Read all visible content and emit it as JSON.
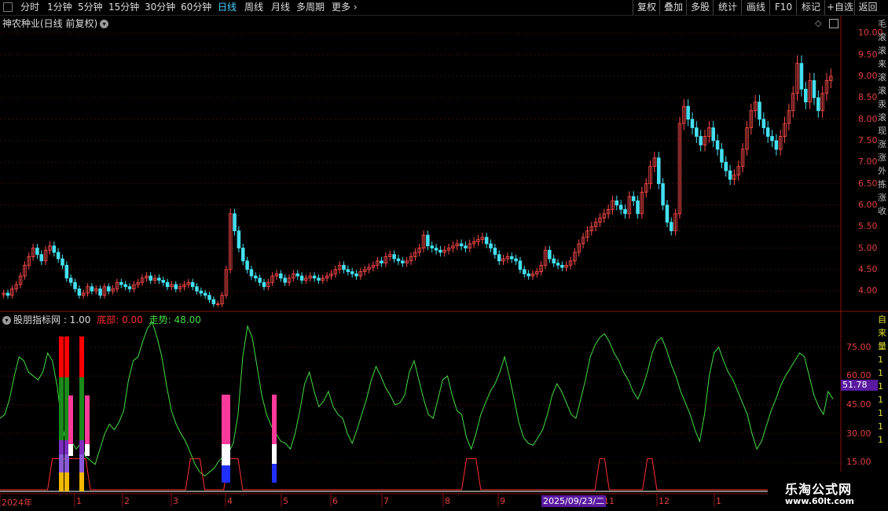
{
  "toolbar": {
    "periods": [
      "分时",
      "1分钟",
      "5分钟",
      "15分钟",
      "30分钟",
      "60分钟",
      "日线",
      "周线",
      "月线",
      "多周期",
      "更多"
    ],
    "active_period": "日线",
    "right_buttons": [
      "复权",
      "叠加",
      "多股",
      "统计",
      "画线",
      "F10",
      "标记",
      "+自选",
      "返回"
    ]
  },
  "main_chart": {
    "title": "神农种业(日线 前复权)",
    "price_axis": [
      "10.00",
      "9.50",
      "9.00",
      "8.50",
      "8.00",
      "7.50",
      "7.00",
      "6.50",
      "6.00",
      "5.50",
      "5.00",
      "4.50",
      "4.00"
    ]
  },
  "indicator": {
    "title": "股朋指标网 : 1.00",
    "bottom_label": "底部: 0.00",
    "trend_label": "走势: 48.00",
    "axis": [
      "75.00",
      "60.00",
      "45.00",
      "30.00",
      "15.00"
    ],
    "readout": "51.78"
  },
  "time_axis": {
    "labels": [
      "2024年",
      "1",
      "2",
      "3",
      "4",
      "5",
      "6",
      "7",
      "8",
      "9",
      "2025/09/23/二",
      "11",
      "12",
      "1"
    ]
  },
  "watermark": {
    "line1": "乐淘公式网",
    "line2": "www.60lt.com"
  },
  "right_strip_glyphs": [
    "毛",
    "滚",
    "滚",
    "来",
    "滚",
    "滚",
    "汞",
    "滚",
    "现",
    "涨",
    "涨",
    "外",
    "拣",
    "涨",
    "收"
  ],
  "right_strip_glyphs_lower": [
    "自",
    "来",
    "量",
    "1",
    "1",
    "1",
    "1",
    "1",
    "1",
    "1"
  ],
  "colors": {
    "up": "#ff4b4b",
    "down": "#44e0f0",
    "trend": "#44dd44",
    "bottom": "#ff3030",
    "accent": "#5a1aa0",
    "axis": "#e04040"
  },
  "chart_data": {
    "type": "candlestick",
    "price_ylim": [
      3.6,
      10.3
    ],
    "price_closes": [
      3.95,
      3.9,
      4.05,
      4.15,
      4.35,
      4.6,
      4.8,
      5.0,
      4.85,
      4.7,
      4.95,
      5.05,
      4.9,
      4.75,
      4.6,
      4.3,
      4.2,
      4.05,
      3.9,
      3.95,
      4.1,
      4.0,
      4.05,
      3.9,
      4.1,
      4.0,
      4.05,
      4.2,
      4.15,
      4.1,
      4.05,
      4.15,
      4.2,
      4.3,
      4.35,
      4.25,
      4.3,
      4.25,
      4.2,
      4.1,
      4.15,
      4.05,
      4.1,
      4.15,
      4.2,
      4.1,
      4.0,
      3.95,
      3.9,
      3.8,
      3.7,
      3.7,
      3.9,
      4.5,
      5.8,
      5.4,
      5.0,
      4.7,
      4.5,
      4.35,
      4.3,
      4.2,
      4.1,
      4.2,
      4.35,
      4.4,
      4.3,
      4.2,
      4.3,
      4.4,
      4.35,
      4.25,
      4.3,
      4.35,
      4.3,
      4.25,
      4.3,
      4.35,
      4.4,
      4.5,
      4.6,
      4.5,
      4.45,
      4.4,
      4.35,
      4.45,
      4.5,
      4.55,
      4.6,
      4.7,
      4.65,
      4.8,
      4.85,
      4.75,
      4.7,
      4.65,
      4.7,
      4.8,
      4.9,
      5.0,
      5.3,
      5.05,
      5.0,
      4.95,
      4.9,
      4.95,
      5.0,
      5.05,
      5.1,
      5.05,
      5.0,
      5.1,
      5.15,
      5.2,
      5.25,
      5.1,
      5.0,
      4.85,
      4.7,
      4.75,
      4.8,
      4.75,
      4.7,
      4.5,
      4.4,
      4.35,
      4.4,
      4.45,
      4.6,
      4.95,
      4.75,
      4.65,
      4.6,
      4.55,
      4.6,
      4.7,
      4.9,
      5.1,
      5.25,
      5.4,
      5.5,
      5.6,
      5.7,
      5.8,
      5.9,
      6.1,
      6.0,
      5.9,
      5.8,
      6.2,
      6.1,
      5.8,
      6.3,
      6.5,
      6.9,
      7.1,
      6.5,
      6.0,
      5.6,
      5.4,
      5.8,
      7.9,
      8.3,
      8.0,
      7.8,
      7.6,
      7.4,
      7.6,
      7.8,
      7.5,
      7.3,
      7.0,
      6.8,
      6.6,
      6.7,
      6.9,
      7.3,
      7.8,
      8.2,
      8.4,
      8.0,
      7.8,
      7.6,
      7.5,
      7.3,
      7.6,
      7.9,
      8.2,
      8.6,
      9.3,
      8.7,
      8.4,
      8.9,
      8.5,
      8.2,
      8.6,
      8.9,
      9.0
    ],
    "trend_ylim": [
      0,
      90
    ],
    "trend_values": [
      38,
      40,
      48,
      60,
      70,
      68,
      62,
      60,
      58,
      62,
      72,
      68,
      55,
      35,
      24,
      26,
      22,
      25,
      18,
      16,
      14,
      22,
      30,
      35,
      32,
      36,
      42,
      58,
      68,
      70,
      78,
      85,
      88,
      80,
      70,
      55,
      42,
      35,
      30,
      26,
      20,
      14,
      10,
      8,
      10,
      12,
      16,
      18,
      20,
      25,
      40,
      70,
      86,
      80,
      65,
      50,
      40,
      34,
      30,
      26,
      25,
      22,
      30,
      42,
      56,
      62,
      52,
      44,
      47,
      52,
      44,
      40,
      38,
      30,
      25,
      32,
      40,
      48,
      58,
      65,
      60,
      54,
      50,
      45,
      46,
      50,
      62,
      68,
      58,
      48,
      40,
      38,
      48,
      58,
      60,
      50,
      42,
      40,
      28,
      22,
      30,
      40,
      46,
      52,
      56,
      62,
      70,
      60,
      48,
      36,
      28,
      25,
      24,
      28,
      32,
      40,
      50,
      56,
      52,
      46,
      40,
      38,
      48,
      58,
      70,
      76,
      80,
      82,
      78,
      72,
      68,
      62,
      58,
      52,
      48,
      54,
      62,
      72,
      78,
      80,
      74,
      66,
      60,
      52,
      46,
      40,
      32,
      26,
      40,
      60,
      72,
      75,
      68,
      62,
      58,
      52,
      46,
      40,
      30,
      22,
      26,
      34,
      42,
      48,
      55,
      60,
      64,
      68,
      72,
      70,
      60,
      50,
      44,
      40,
      52,
      48
    ],
    "bottom_spikes_index": [
      11,
      12,
      13,
      14,
      15,
      16,
      17,
      18,
      40,
      41,
      42,
      48,
      49,
      50,
      98,
      99,
      100,
      126,
      127,
      136,
      137
    ],
    "indicator_ylim": [
      0,
      90
    ]
  }
}
